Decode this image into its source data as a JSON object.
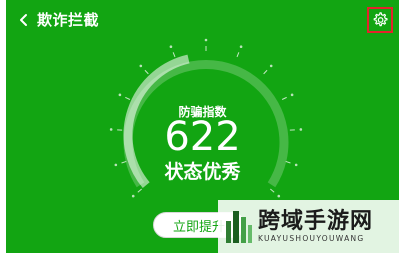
{
  "header": {
    "title": "欺诈拦截",
    "back_icon": "chevron-left-icon",
    "settings_icon": "gear-icon"
  },
  "gauge": {
    "label": "防骗指数",
    "score": "622",
    "status": "状态优秀",
    "scale_min": 350,
    "scale_max": 950,
    "progress_ratio": 0.45
  },
  "action_button": {
    "label": "立即提升"
  },
  "watermark": {
    "name": "跨域手游网",
    "subtitle": "KUAYUSHOUYOUWANG"
  },
  "colors": {
    "background": "#12a512",
    "highlight_box": "#e3242b",
    "text": "#ffffff"
  }
}
